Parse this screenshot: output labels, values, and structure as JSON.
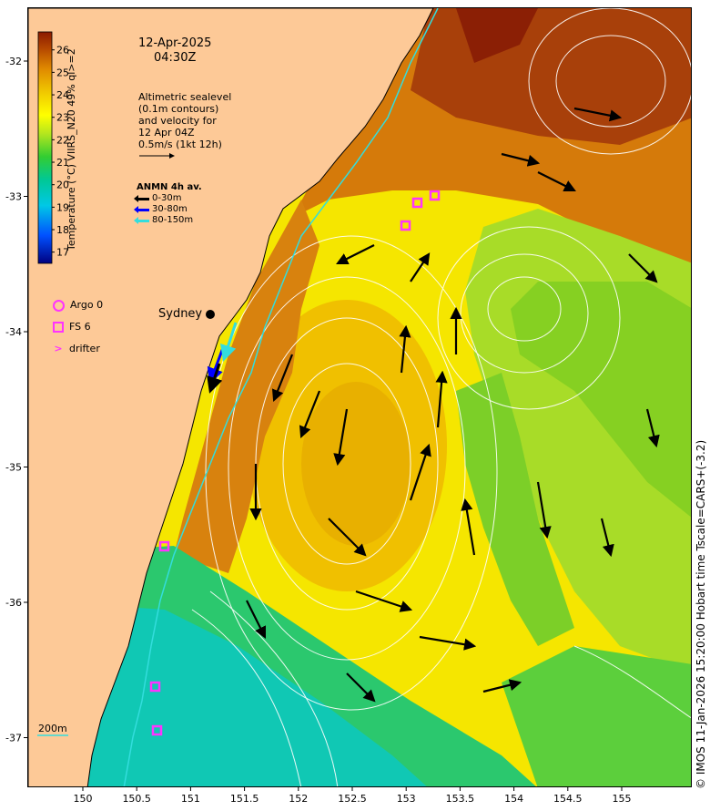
{
  "map": {
    "title_date": "12-Apr-2025",
    "title_time": "04:30Z",
    "altimetry_note": [
      "Altimetric sealevel",
      "(0.1m contours)",
      "and velocity for",
      "12 Apr 04Z",
      "0.5m/s (1kt 12h)"
    ],
    "anmn_title": "ANMN 4h av.",
    "anmn_legend": [
      {
        "label": "0-30m",
        "color": "#000000"
      },
      {
        "label": "30-80m",
        "color": "#0000ff"
      },
      {
        "label": "80-150m",
        "color": "#33dddd"
      }
    ],
    "symbol_legend": [
      {
        "symbol": "circle",
        "label": "Argo 0"
      },
      {
        "symbol": "square",
        "label": "FS 6"
      },
      {
        "symbol": "chevron",
        "label": "drifter"
      }
    ],
    "city": "Sydney",
    "depth_contour_label": "200m",
    "credit": "© IMOS 11-Jan-2026 15:20:00 Hobart time Tscale=CARS+(-3.2)",
    "colorbar": {
      "title": "Temperature (°C) VIIRS_N20 49% ql>=2",
      "ticks": [
        "17",
        "18",
        "19",
        "20",
        "21",
        "22",
        "23",
        "24",
        "25",
        "26"
      ],
      "min": 16.5,
      "max": 26.8
    },
    "lon_ticks": [
      "150",
      "150.5",
      "151",
      "151.5",
      "152",
      "152.5",
      "153",
      "153.5",
      "154",
      "154.5",
      "155"
    ],
    "lat_ticks": [
      "-32",
      "-33",
      "-34",
      "-35",
      "-36",
      "-37"
    ],
    "colors": {
      "land": "#fdc997",
      "coast": "#000000",
      "contour": "#ffffff",
      "fs_marker": "#ff33ff",
      "current_80_150m": "#33dddd"
    }
  }
}
